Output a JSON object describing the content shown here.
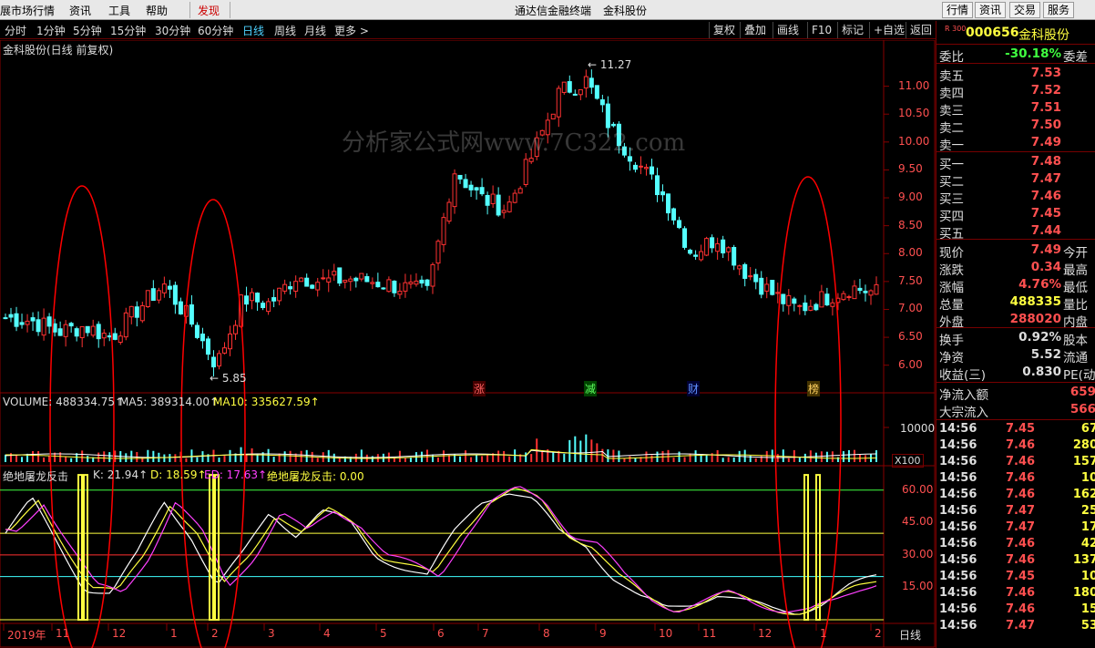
{
  "menu": {
    "items": [
      "展市场行情",
      "资讯",
      "工具",
      "帮助",
      "发现"
    ],
    "center_title": "通达信金融终端",
    "stock_title": "金科股份",
    "right_buttons": [
      "行情",
      "资讯",
      "交易",
      "服务"
    ]
  },
  "period_bar": {
    "items": [
      "分时",
      "1分钟",
      "5分钟",
      "15分钟",
      "30分钟",
      "60分钟",
      "日线",
      "周线",
      "月线",
      "更多 >"
    ],
    "active": "日线",
    "right_buttons": [
      "复权",
      "叠加",
      "画线",
      "F10",
      "标记",
      "+自选",
      "返回"
    ]
  },
  "chart": {
    "title": "金科股份(日线 前复权)",
    "watermark": "分析家公式网www.7C322.com",
    "high_label": "11.27",
    "low_label": "5.85",
    "price_axis": [
      "11.00",
      "10.50",
      "10.00",
      "9.50",
      "9.00",
      "8.50",
      "8.00",
      "7.50",
      "7.00",
      "6.50",
      "6.00"
    ],
    "event_tags": [
      "涨",
      "减",
      "财",
      "榜"
    ],
    "volume_header": {
      "vol": "VOLUME: 488334.75↑",
      "ma5": "MA5: 389314.00↑",
      "ma10": "MA10: 335627.59↑"
    },
    "volume_axis": "10000",
    "volume_unit": "X100",
    "indicator_header": {
      "name": "绝地屠龙反击",
      "k": "K: 21.94↑",
      "d": "D: 18.59↑",
      "ed": "ED: 17.63↑",
      "sig": "绝地屠龙反击: 0.00"
    },
    "indicator_axis": [
      "60.00",
      "45.00",
      "30.00",
      "15.00"
    ],
    "date_axis": [
      "2019年",
      "11",
      "12",
      "1",
      "2",
      "3",
      "4",
      "5",
      "6",
      "7",
      "8",
      "9",
      "10",
      "11",
      "12",
      "1",
      "2"
    ],
    "period_label": "日线",
    "colors": {
      "up": "#ff3232",
      "down": "#54ffff",
      "k": "#ffffff",
      "d": "#ffff40",
      "ed": "#ff40ff",
      "ellipse": "#ff0000"
    }
  },
  "chart_data": {
    "type": "line",
    "xlabel": "",
    "ylabel": "",
    "ylim": [
      5.75,
      11.5
    ],
    "x": [
      "2019-10-21",
      "2019-11-05",
      "2019-11-20",
      "2019-12-05",
      "2019-12-20",
      "2020-01-06",
      "2020-01-21",
      "2020-02-04",
      "2020-02-19",
      "2020-03-05",
      "2020-03-20",
      "2020-04-07",
      "2020-04-22",
      "2020-05-11",
      "2020-05-26",
      "2020-06-10",
      "2020-06-29",
      "2020-07-06",
      "2020-07-13",
      "2020-07-27",
      "2020-08-10",
      "2020-08-20",
      "2020-08-26",
      "2020-09-08",
      "2020-09-22",
      "2020-10-14",
      "2020-10-28",
      "2020-11-11",
      "2020-11-25",
      "2020-12-09",
      "2020-12-23",
      "2021-01-08",
      "2021-01-22",
      "2021-02-05"
    ],
    "series": [
      {
        "values": [
          6.85,
          6.8,
          6.6,
          6.7,
          6.5,
          7.0,
          7.45,
          6.8,
          6.0,
          7.2,
          7.1,
          7.6,
          7.5,
          7.55,
          7.5,
          7.4,
          7.3,
          9.5,
          9.0,
          8.8,
          9.8,
          10.9,
          11.1,
          10.2,
          9.6,
          9.0,
          8.0,
          8.3,
          7.7,
          7.3,
          7.0,
          7.2,
          7.4,
          7.3
        ]
      }
    ],
    "volume_series": {
      "name": "VOLUME",
      "last": 488334.75,
      "ma5": 389314.0,
      "ma10": 335627.59
    },
    "indicator": {
      "name": "绝地屠龙反击",
      "k": 21.94,
      "d": 18.59,
      "ed": 17.63,
      "signal": 0.0,
      "ylim": [
        0,
        70
      ],
      "k_values": [
        40,
        55,
        35,
        15,
        12,
        30,
        55,
        40,
        15,
        30,
        50,
        40,
        50,
        45,
        30,
        25,
        20,
        40,
        55,
        60,
        55,
        40,
        35,
        20,
        10,
        5,
        8,
        12,
        8,
        5,
        4,
        8,
        15,
        20
      ]
    }
  },
  "panel": {
    "code": "000656",
    "name": "金科股份",
    "market_badge": "R 300",
    "weibi": {
      "label": "委比",
      "value": "-30.18%",
      "right": "委差"
    },
    "asks": [
      {
        "l": "卖五",
        "v": "7.53"
      },
      {
        "l": "卖四",
        "v": "7.52"
      },
      {
        "l": "卖三",
        "v": "7.51"
      },
      {
        "l": "卖二",
        "v": "7.50"
      },
      {
        "l": "卖一",
        "v": "7.49"
      }
    ],
    "bids": [
      {
        "l": "买一",
        "v": "7.48"
      },
      {
        "l": "买二",
        "v": "7.47"
      },
      {
        "l": "买三",
        "v": "7.46"
      },
      {
        "l": "买四",
        "v": "7.45"
      },
      {
        "l": "买五",
        "v": "7.44"
      }
    ],
    "quote": [
      {
        "l": "现价",
        "v": "7.49",
        "c": "今开",
        "color": "#ff5050"
      },
      {
        "l": "涨跌",
        "v": "0.34",
        "c": "最高",
        "color": "#ff5050"
      },
      {
        "l": "涨幅",
        "v": "4.76%",
        "c": "最低",
        "color": "#ff5050"
      },
      {
        "l": "总量",
        "v": "488335",
        "c": "量比",
        "color": "#ffff40"
      },
      {
        "l": "外盘",
        "v": "288020",
        "c": "内盘",
        "color": "#ff5050"
      }
    ],
    "stats": [
      {
        "l": "换手",
        "v": "0.92%",
        "c": "股本"
      },
      {
        "l": "净资",
        "v": "5.52",
        "c": "流通"
      },
      {
        "l": "收益(三)",
        "v": "0.830",
        "c": "PE(动)"
      }
    ],
    "flow": [
      {
        "l": "净流入额",
        "v": "659"
      },
      {
        "l": "大宗流入",
        "v": "566"
      }
    ],
    "ticks": [
      {
        "t": "14:56",
        "p": "7.45",
        "v": "67"
      },
      {
        "t": "14:56",
        "p": "7.46",
        "v": "280"
      },
      {
        "t": "14:56",
        "p": "7.46",
        "v": "157"
      },
      {
        "t": "14:56",
        "p": "7.46",
        "v": "10"
      },
      {
        "t": "14:56",
        "p": "7.46",
        "v": "162"
      },
      {
        "t": "14:56",
        "p": "7.47",
        "v": "25"
      },
      {
        "t": "14:56",
        "p": "7.47",
        "v": "17"
      },
      {
        "t": "14:56",
        "p": "7.46",
        "v": "42"
      },
      {
        "t": "14:56",
        "p": "7.46",
        "v": "137"
      },
      {
        "t": "14:56",
        "p": "7.45",
        "v": "10"
      },
      {
        "t": "14:56",
        "p": "7.46",
        "v": "180"
      },
      {
        "t": "14:56",
        "p": "7.46",
        "v": "15"
      },
      {
        "t": "14:56",
        "p": "7.47",
        "v": "53"
      }
    ]
  }
}
